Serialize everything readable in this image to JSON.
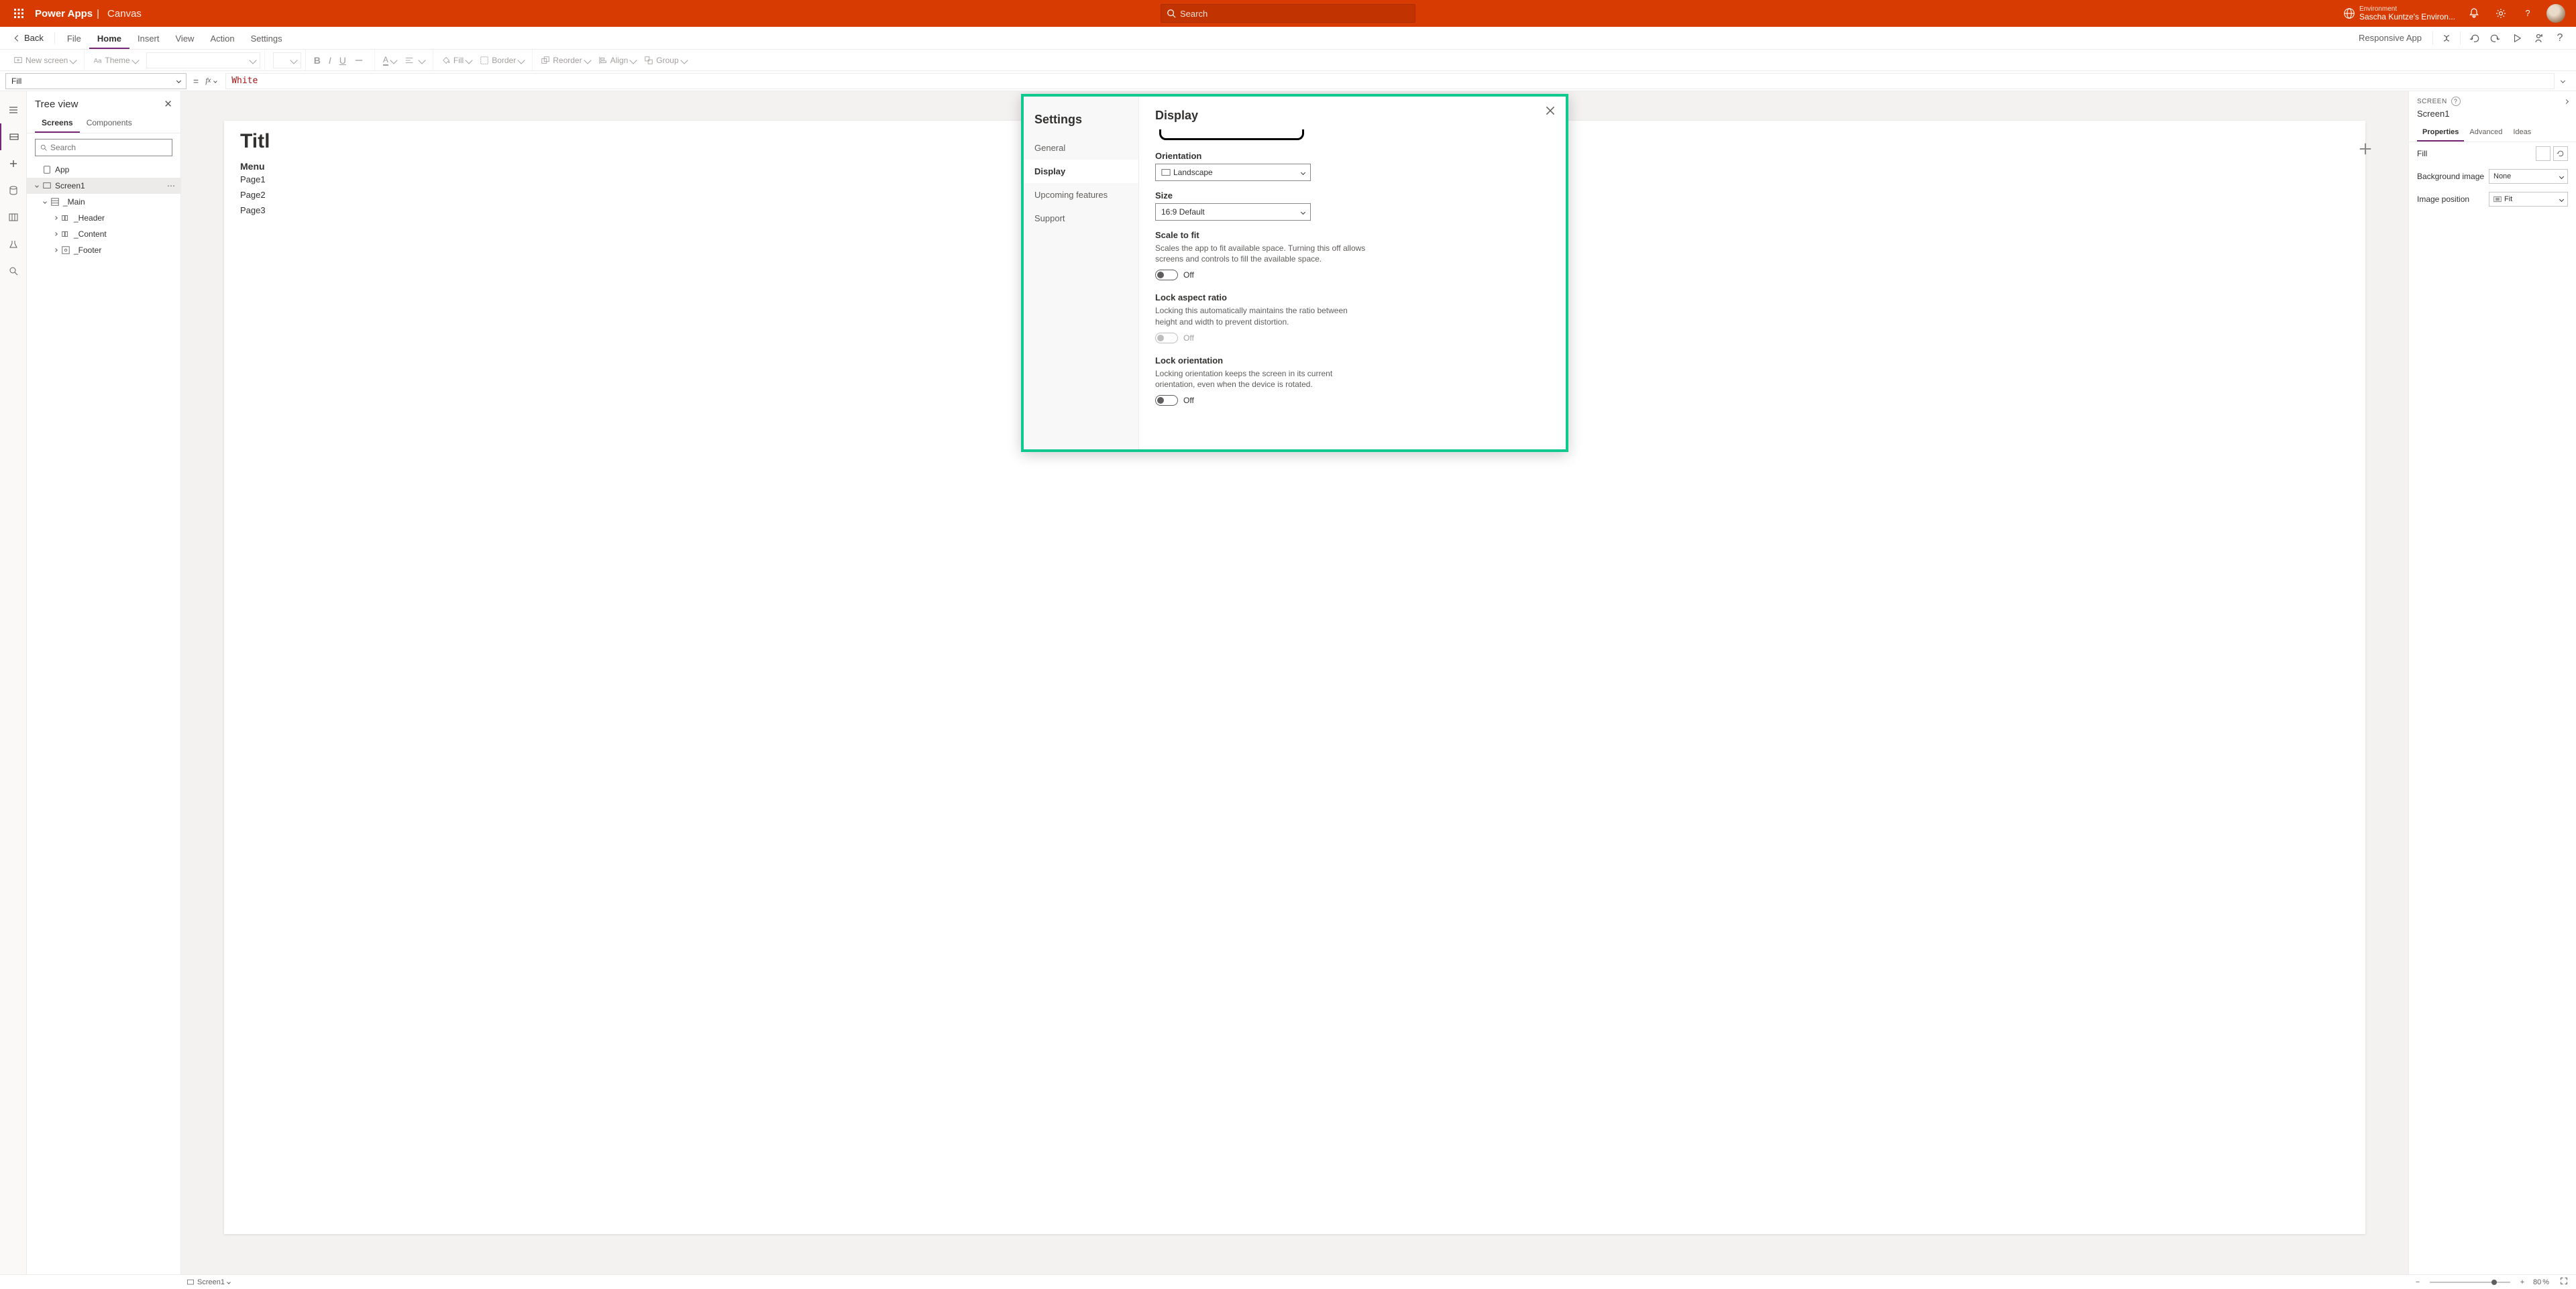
{
  "header": {
    "brand": "Power Apps",
    "mode": "Canvas",
    "search_placeholder": "Search",
    "env_label": "Environment",
    "env_value": "Sascha Kuntze's Environ..."
  },
  "ribbon": {
    "back": "Back",
    "tabs": [
      "File",
      "Home",
      "Insert",
      "View",
      "Action",
      "Settings"
    ],
    "active_tab": "Home",
    "app_name": "Responsive App",
    "new_screen": "New screen",
    "theme": "Theme",
    "fill": "Fill",
    "border": "Border",
    "reorder": "Reorder",
    "align": "Align",
    "group": "Group"
  },
  "formula": {
    "property": "Fill",
    "value": "White"
  },
  "tree": {
    "title": "Tree view",
    "tabs": [
      "Screens",
      "Components"
    ],
    "active": "Screens",
    "search_placeholder": "Search",
    "app": "App",
    "nodes": {
      "screen": "Screen1",
      "main": "_Main",
      "header": "_Header",
      "content": "_Content",
      "footer": "_Footer"
    }
  },
  "canvas": {
    "title": "Titl",
    "menu": "Menu",
    "pages": [
      "Page1",
      "Page2",
      "Page3"
    ]
  },
  "modal": {
    "nav_title": "Settings",
    "nav_items": [
      "General",
      "Display",
      "Upcoming features",
      "Support"
    ],
    "nav_active": "Display",
    "body_title": "Display",
    "orientation_label": "Orientation",
    "orientation_value": "Landscape",
    "size_label": "Size",
    "size_value": "16:9 Default",
    "scale_title": "Scale to fit",
    "scale_desc": "Scales the app to fit available space. Turning this off allows screens and controls to fill the available space.",
    "scale_state": "Off",
    "lock_ratio_title": "Lock aspect ratio",
    "lock_ratio_desc": "Locking this automatically maintains the ratio between height and width to prevent distortion.",
    "lock_ratio_state": "Off",
    "lock_orient_title": "Lock orientation",
    "lock_orient_desc": "Locking orientation keeps the screen in its current orientation, even when the device is rotated.",
    "lock_orient_state": "Off"
  },
  "rpanel": {
    "section": "SCREEN",
    "name": "Screen1",
    "tabs": [
      "Properties",
      "Advanced",
      "Ideas"
    ],
    "active": "Properties",
    "fill_label": "Fill",
    "bg_label": "Background image",
    "bg_value": "None",
    "imgpos_label": "Image position",
    "imgpos_value": "Fit"
  },
  "status": {
    "screen": "Screen1",
    "zoom": "80",
    "zoom_unit": "%"
  }
}
